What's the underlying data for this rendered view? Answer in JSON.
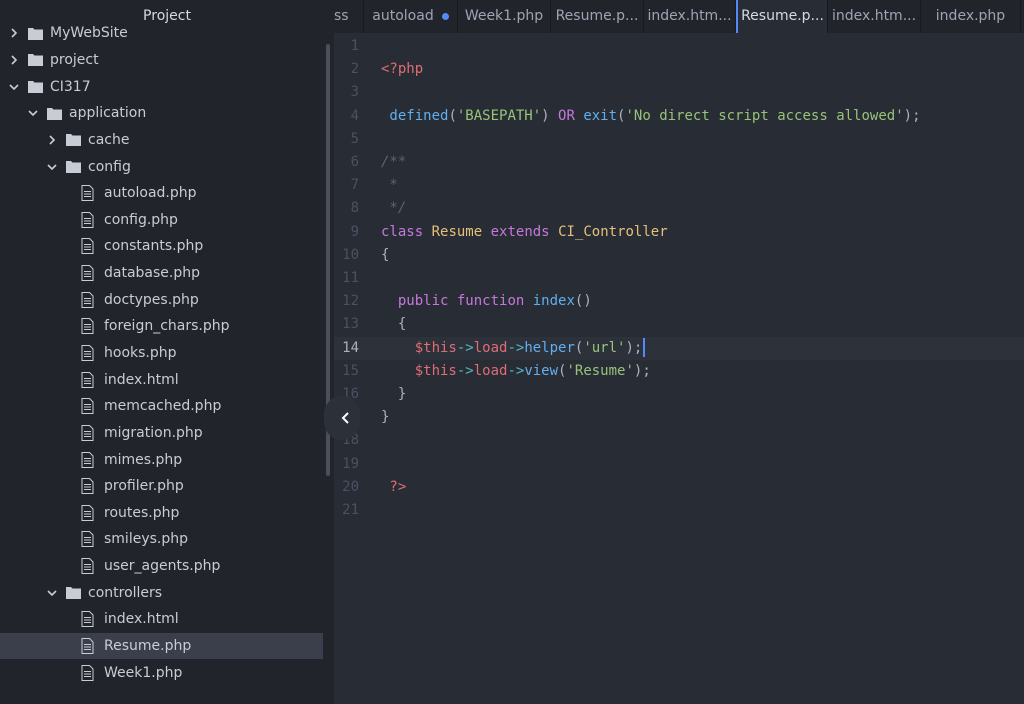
{
  "sidebar": {
    "title": "Project",
    "tree": [
      {
        "label": "MyWebSite",
        "type": "folder",
        "depth": 0,
        "expanded": false
      },
      {
        "label": "project",
        "type": "folder",
        "depth": 0,
        "expanded": false
      },
      {
        "label": "CI317",
        "type": "folder",
        "depth": 0,
        "expanded": true
      },
      {
        "label": "application",
        "type": "folder",
        "depth": 1,
        "expanded": true
      },
      {
        "label": "cache",
        "type": "folder",
        "depth": 2,
        "expanded": false
      },
      {
        "label": "config",
        "type": "folder",
        "depth": 2,
        "expanded": true
      },
      {
        "label": "autoload.php",
        "type": "file",
        "depth": 3
      },
      {
        "label": "config.php",
        "type": "file",
        "depth": 3
      },
      {
        "label": "constants.php",
        "type": "file",
        "depth": 3
      },
      {
        "label": "database.php",
        "type": "file",
        "depth": 3
      },
      {
        "label": "doctypes.php",
        "type": "file",
        "depth": 3
      },
      {
        "label": "foreign_chars.php",
        "type": "file",
        "depth": 3
      },
      {
        "label": "hooks.php",
        "type": "file",
        "depth": 3
      },
      {
        "label": "index.html",
        "type": "file",
        "depth": 3
      },
      {
        "label": "memcached.php",
        "type": "file",
        "depth": 3
      },
      {
        "label": "migration.php",
        "type": "file",
        "depth": 3
      },
      {
        "label": "mimes.php",
        "type": "file",
        "depth": 3
      },
      {
        "label": "profiler.php",
        "type": "file",
        "depth": 3
      },
      {
        "label": "routes.php",
        "type": "file",
        "depth": 3
      },
      {
        "label": "smileys.php",
        "type": "file",
        "depth": 3
      },
      {
        "label": "user_agents.php",
        "type": "file",
        "depth": 3
      },
      {
        "label": "controllers",
        "type": "folder",
        "depth": 2,
        "expanded": true
      },
      {
        "label": "index.html",
        "type": "file",
        "depth": 3
      },
      {
        "label": "Resume.php",
        "type": "file",
        "depth": 3,
        "selected": true
      },
      {
        "label": "Week1.php",
        "type": "file",
        "depth": 3
      }
    ]
  },
  "tabs": [
    {
      "label": "ss",
      "active": false
    },
    {
      "label": "autoload",
      "active": false,
      "modified": true
    },
    {
      "label": "Week1.php",
      "active": false
    },
    {
      "label": "Resume.p...",
      "active": false
    },
    {
      "label": "index.htm...",
      "active": false
    },
    {
      "label": "Resume.p...",
      "active": true
    },
    {
      "label": "index.htm...",
      "active": false
    },
    {
      "label": "index.php",
      "active": false
    }
  ],
  "editor": {
    "cursor_line": 14,
    "lines": [
      {
        "n": "1",
        "tokens": []
      },
      {
        "n": "2",
        "tokens": [
          {
            "t": "<?php",
            "c": "tag"
          }
        ]
      },
      {
        "n": "3",
        "tokens": []
      },
      {
        "n": "4",
        "tokens": [
          {
            "t": " defined",
            "c": "fn"
          },
          {
            "t": "(",
            "c": "pun"
          },
          {
            "t": "'BASEPATH'",
            "c": "str"
          },
          {
            "t": ") ",
            "c": "pun"
          },
          {
            "t": "OR",
            "c": "kw"
          },
          {
            "t": " exit",
            "c": "fn"
          },
          {
            "t": "(",
            "c": "pun"
          },
          {
            "t": "'No direct script access allowed'",
            "c": "str"
          },
          {
            "t": ");",
            "c": "pun"
          }
        ]
      },
      {
        "n": "5",
        "tokens": []
      },
      {
        "n": "6",
        "tokens": [
          {
            "t": "/**",
            "c": "cmt"
          }
        ]
      },
      {
        "n": "7",
        "tokens": [
          {
            "t": " *",
            "c": "cmt"
          }
        ]
      },
      {
        "n": "8",
        "tokens": [
          {
            "t": " */",
            "c": "cmt"
          }
        ]
      },
      {
        "n": "9",
        "tokens": [
          {
            "t": "class",
            "c": "kw"
          },
          {
            "t": " ",
            "c": "plain"
          },
          {
            "t": "Resume",
            "c": "cls"
          },
          {
            "t": " ",
            "c": "plain"
          },
          {
            "t": "extends",
            "c": "kw"
          },
          {
            "t": " ",
            "c": "plain"
          },
          {
            "t": "CI_Controller",
            "c": "cls"
          }
        ]
      },
      {
        "n": "10",
        "tokens": [
          {
            "t": "{",
            "c": "pun"
          }
        ]
      },
      {
        "n": "11",
        "tokens": []
      },
      {
        "n": "12",
        "tokens": [
          {
            "t": "  public",
            "c": "kw"
          },
          {
            "t": " ",
            "c": "plain"
          },
          {
            "t": "function",
            "c": "kw"
          },
          {
            "t": " ",
            "c": "plain"
          },
          {
            "t": "index",
            "c": "fn"
          },
          {
            "t": "()",
            "c": "pun"
          }
        ]
      },
      {
        "n": "13",
        "tokens": [
          {
            "t": "  {",
            "c": "pun"
          }
        ]
      },
      {
        "n": "14",
        "tokens": [
          {
            "t": "    ",
            "c": "plain"
          },
          {
            "t": "$this",
            "c": "var"
          },
          {
            "t": "->",
            "c": "op"
          },
          {
            "t": "load",
            "c": "var"
          },
          {
            "t": "->",
            "c": "op"
          },
          {
            "t": "helper",
            "c": "fn"
          },
          {
            "t": "(",
            "c": "pun"
          },
          {
            "t": "'url'",
            "c": "str"
          },
          {
            "t": ");",
            "c": "pun"
          }
        ]
      },
      {
        "n": "15",
        "tokens": [
          {
            "t": "    ",
            "c": "plain"
          },
          {
            "t": "$this",
            "c": "var"
          },
          {
            "t": "->",
            "c": "op"
          },
          {
            "t": "load",
            "c": "var"
          },
          {
            "t": "->",
            "c": "op"
          },
          {
            "t": "view",
            "c": "fn"
          },
          {
            "t": "(",
            "c": "pun"
          },
          {
            "t": "'Resume'",
            "c": "str"
          },
          {
            "t": ");",
            "c": "pun"
          }
        ]
      },
      {
        "n": "16",
        "tokens": [
          {
            "t": "  }",
            "c": "pun"
          }
        ]
      },
      {
        "n": "17",
        "tokens": [
          {
            "t": "}",
            "c": "pun"
          }
        ]
      },
      {
        "n": "18",
        "tokens": []
      },
      {
        "n": "19",
        "tokens": []
      },
      {
        "n": "20",
        "tokens": [
          {
            "t": " ?>",
            "c": "tag"
          }
        ]
      },
      {
        "n": "21",
        "tokens": []
      }
    ]
  },
  "colors": {
    "accent": "#568af2",
    "sidebar_bg": "#21252b",
    "editor_bg": "#282c34"
  }
}
